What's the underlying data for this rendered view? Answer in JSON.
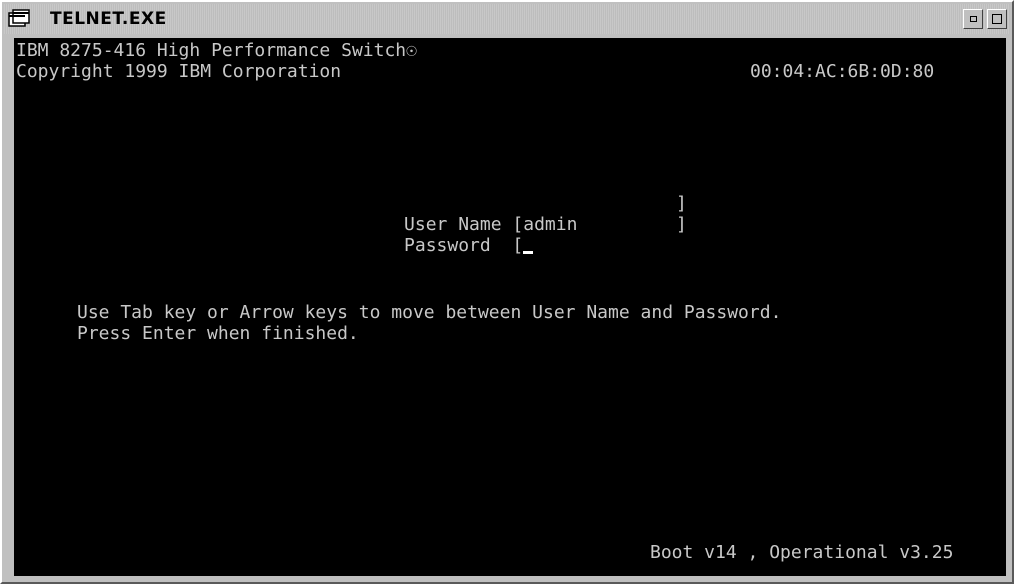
{
  "window": {
    "title": "TELNET.EXE",
    "icon": "terminal-window-icon",
    "minimize_icon": "minimize-icon",
    "maximize_icon": "maximize-icon"
  },
  "terminal": {
    "header_line1": "IBM 8275-416 High Performance Switch☉",
    "copyright": "Copyright 1999 IBM Corporation",
    "mac_address": "00:04:AC:6B:0D:80",
    "login": {
      "username_label": "User Name [",
      "username_value": "admin",
      "username_close": "]",
      "password_label": "Password  [",
      "password_value": "",
      "password_close": "]"
    },
    "help_line1": "Use Tab key or Arrow keys to move between User Name and Password.",
    "help_line2": "Press Enter when finished.",
    "version": "Boot v14 , Operational v3.25"
  },
  "colors": {
    "terminal_bg": "#000000",
    "terminal_fg": "#c8c8c8",
    "chrome": "#c0c0c0"
  }
}
